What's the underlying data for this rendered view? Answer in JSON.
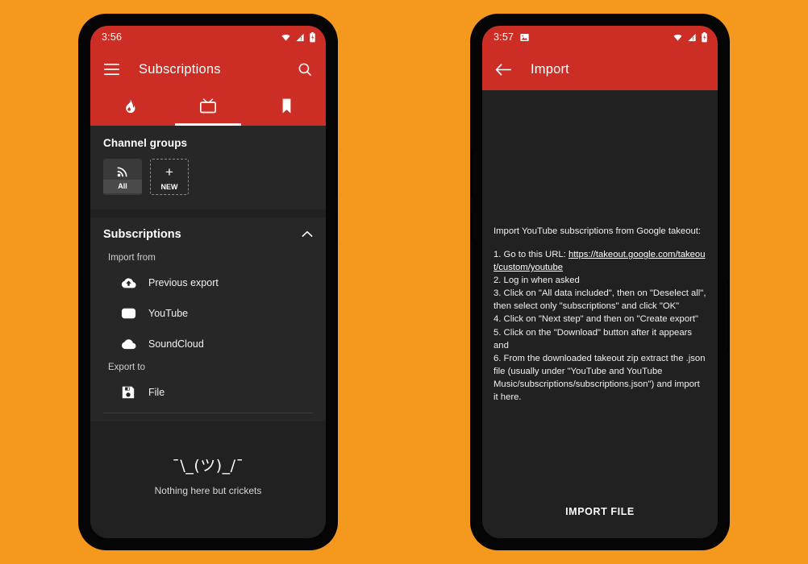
{
  "theme": {
    "background": "#f5981e",
    "accent_red": "#cc2d25",
    "surface_dark": "#212121",
    "surface_elevated": "#272727"
  },
  "phone_left": {
    "status_bar": {
      "time": "3:56",
      "icons": [
        "wifi-icon",
        "signal-warning-icon",
        "battery-icon"
      ]
    },
    "app_bar": {
      "menu_icon": "hamburger-menu-icon",
      "title": "Subscriptions",
      "search_icon": "search-icon"
    },
    "tabs": [
      {
        "icon": "flame-icon",
        "name": "trending",
        "active": false
      },
      {
        "icon": "tv-icon",
        "name": "subscriptions",
        "active": true
      },
      {
        "icon": "bookmark-icon",
        "name": "bookmarks",
        "active": false
      }
    ],
    "channel_groups": {
      "title": "Channel groups",
      "chips": [
        {
          "label": "All",
          "icon": "rss-icon",
          "style": "filled"
        },
        {
          "label": "NEW",
          "icon": "plus-icon",
          "style": "dashed"
        }
      ]
    },
    "subscriptions_section": {
      "title": "Subscriptions",
      "collapse_icon": "chevron-up-icon",
      "import_caption": "Import from",
      "import_items": [
        {
          "label": "Previous export",
          "icon": "cloud-upload-icon"
        },
        {
          "label": "YouTube",
          "icon": "youtube-icon"
        },
        {
          "label": "SoundCloud",
          "icon": "cloud-icon"
        }
      ],
      "export_caption": "Export to",
      "export_items": [
        {
          "label": "File",
          "icon": "save-disk-icon"
        }
      ]
    },
    "empty_state": {
      "art": "¯\\_(ツ)_/¯",
      "text": "Nothing here but crickets"
    }
  },
  "phone_right": {
    "status_bar": {
      "time": "3:57",
      "icons": [
        "image-icon",
        "wifi-icon",
        "signal-warning-icon",
        "battery-icon"
      ]
    },
    "app_bar": {
      "back_icon": "arrow-back-icon",
      "title": "Import"
    },
    "instructions": {
      "intro": "Import YouTube subscriptions from Google takeout:",
      "step1_prefix": "1. Go to this URL: ",
      "step1_url": "https://takeout.google.com/takeout/custom/youtube",
      "step2": "2. Log in when asked",
      "step3": "3. Click on \"All data included\", then on \"Deselect all\", then select only \"subscriptions\" and click \"OK\"",
      "step4": "4. Click on \"Next step\" and then on \"Create export\"",
      "step5": "5. Click on the \"Download\" button after it appears and",
      "step6": "6. From the downloaded takeout zip extract the .json file (usually under \"YouTube and YouTube Music/subscriptions/subscriptions.json\") and import it here."
    },
    "import_button_label": "IMPORT FILE"
  }
}
